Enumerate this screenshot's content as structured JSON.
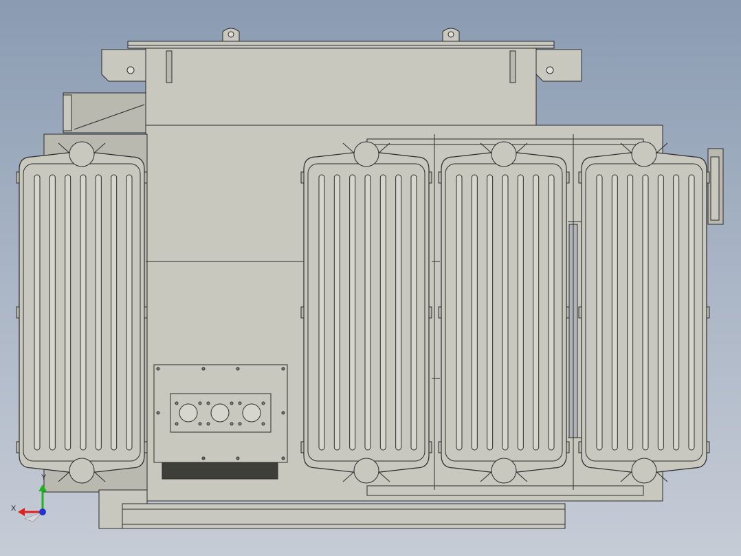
{
  "scene": {
    "background_top": "#8a9bb2",
    "background_bottom": "#c6ccd6",
    "part_fill": "#c8c8bf",
    "part_shade": "#b9b9b0",
    "edge_color": "#2b2b2b",
    "dark_plate": "#3f3f3a"
  },
  "triad": {
    "x_label": "X",
    "y_label": "Y",
    "x_color": "#e0201a",
    "y_color": "#1fb31f",
    "origin_color": "#2233cc"
  },
  "radiators": {
    "count": 4,
    "fins_per_radiator": 7
  },
  "terminal_panel": {
    "bushing_holes": 3
  }
}
